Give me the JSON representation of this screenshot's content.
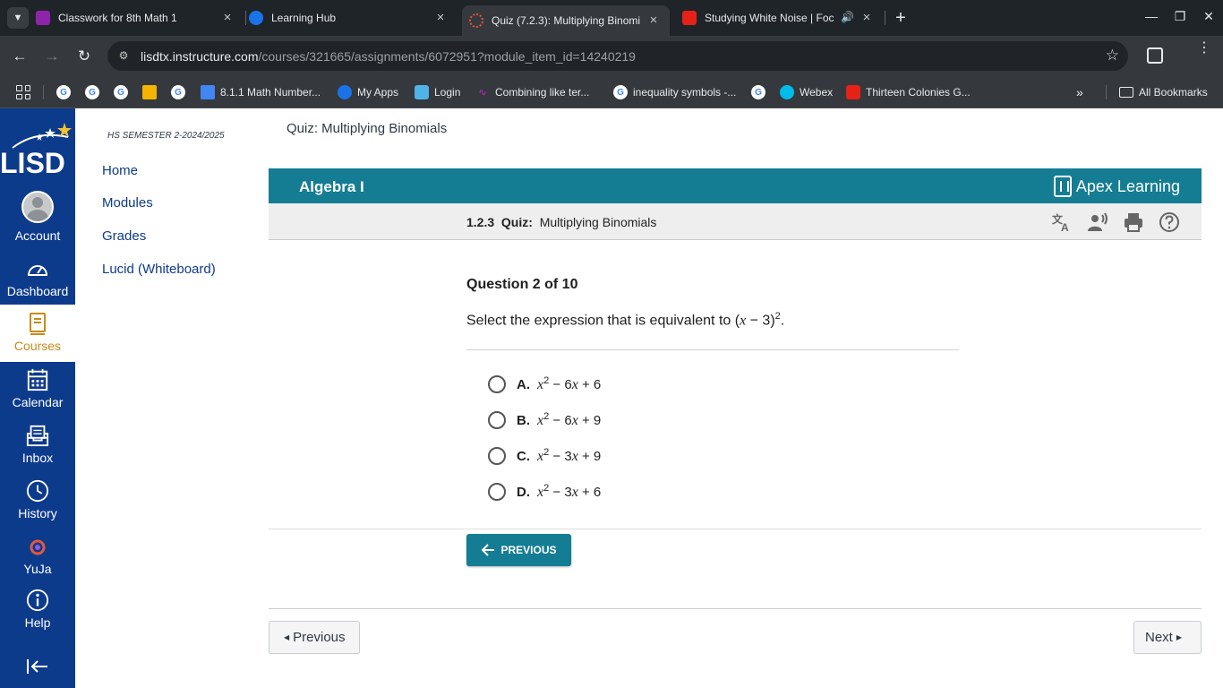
{
  "browser": {
    "tabs": [
      {
        "title": "Classwork for 8th Math 1"
      },
      {
        "title": "Learning Hub"
      },
      {
        "title": "Quiz (7.2.3): Multiplying Binomi"
      },
      {
        "title": "Studying White Noise | Foc"
      }
    ],
    "url_host": "lisdtx.instructure.com",
    "url_path": "/courses/321665/assignments/6072951?module_item_id=14240219",
    "bookmarks": [
      {
        "label": "8.1.1 Math Number..."
      },
      {
        "label": "My Apps"
      },
      {
        "label": "Login"
      },
      {
        "label": "Combining like ter..."
      },
      {
        "label": "inequality symbols -..."
      },
      {
        "label": "Webex"
      },
      {
        "label": "Thirteen Colonies G..."
      },
      {
        "label": "All Bookmarks"
      }
    ]
  },
  "global_nav": {
    "logo": "LISD",
    "items": [
      {
        "label": "Account"
      },
      {
        "label": "Dashboard"
      },
      {
        "label": "Courses"
      },
      {
        "label": "Calendar"
      },
      {
        "label": "Inbox"
      },
      {
        "label": "History"
      },
      {
        "label": "YuJa"
      },
      {
        "label": "Help"
      }
    ]
  },
  "course_nav": {
    "term": "HS SEMESTER 2-2024/2025",
    "items": [
      {
        "label": "Home"
      },
      {
        "label": "Modules"
      },
      {
        "label": "Grades"
      },
      {
        "label": "Lucid (Whiteboard)"
      }
    ]
  },
  "page": {
    "title": "Quiz: Multiplying Binomials",
    "course": "Algebra I",
    "brand": "Apex Learning",
    "crumb_number": "1.2.3",
    "crumb_type": "Quiz:",
    "crumb_name": "Multiplying Binomials"
  },
  "question": {
    "counter": "Question 2 of 10",
    "prompt": "Select the expression that is equivalent to",
    "options": [
      {
        "letter": "A.",
        "b": "6",
        "c": "6"
      },
      {
        "letter": "B.",
        "b": "6",
        "c": "9"
      },
      {
        "letter": "C.",
        "b": "3",
        "c": "9"
      },
      {
        "letter": "D.",
        "b": "3",
        "c": "6"
      }
    ]
  },
  "buttons": {
    "apex_previous": "PREVIOUS",
    "previous": "Previous",
    "next": "Next"
  }
}
